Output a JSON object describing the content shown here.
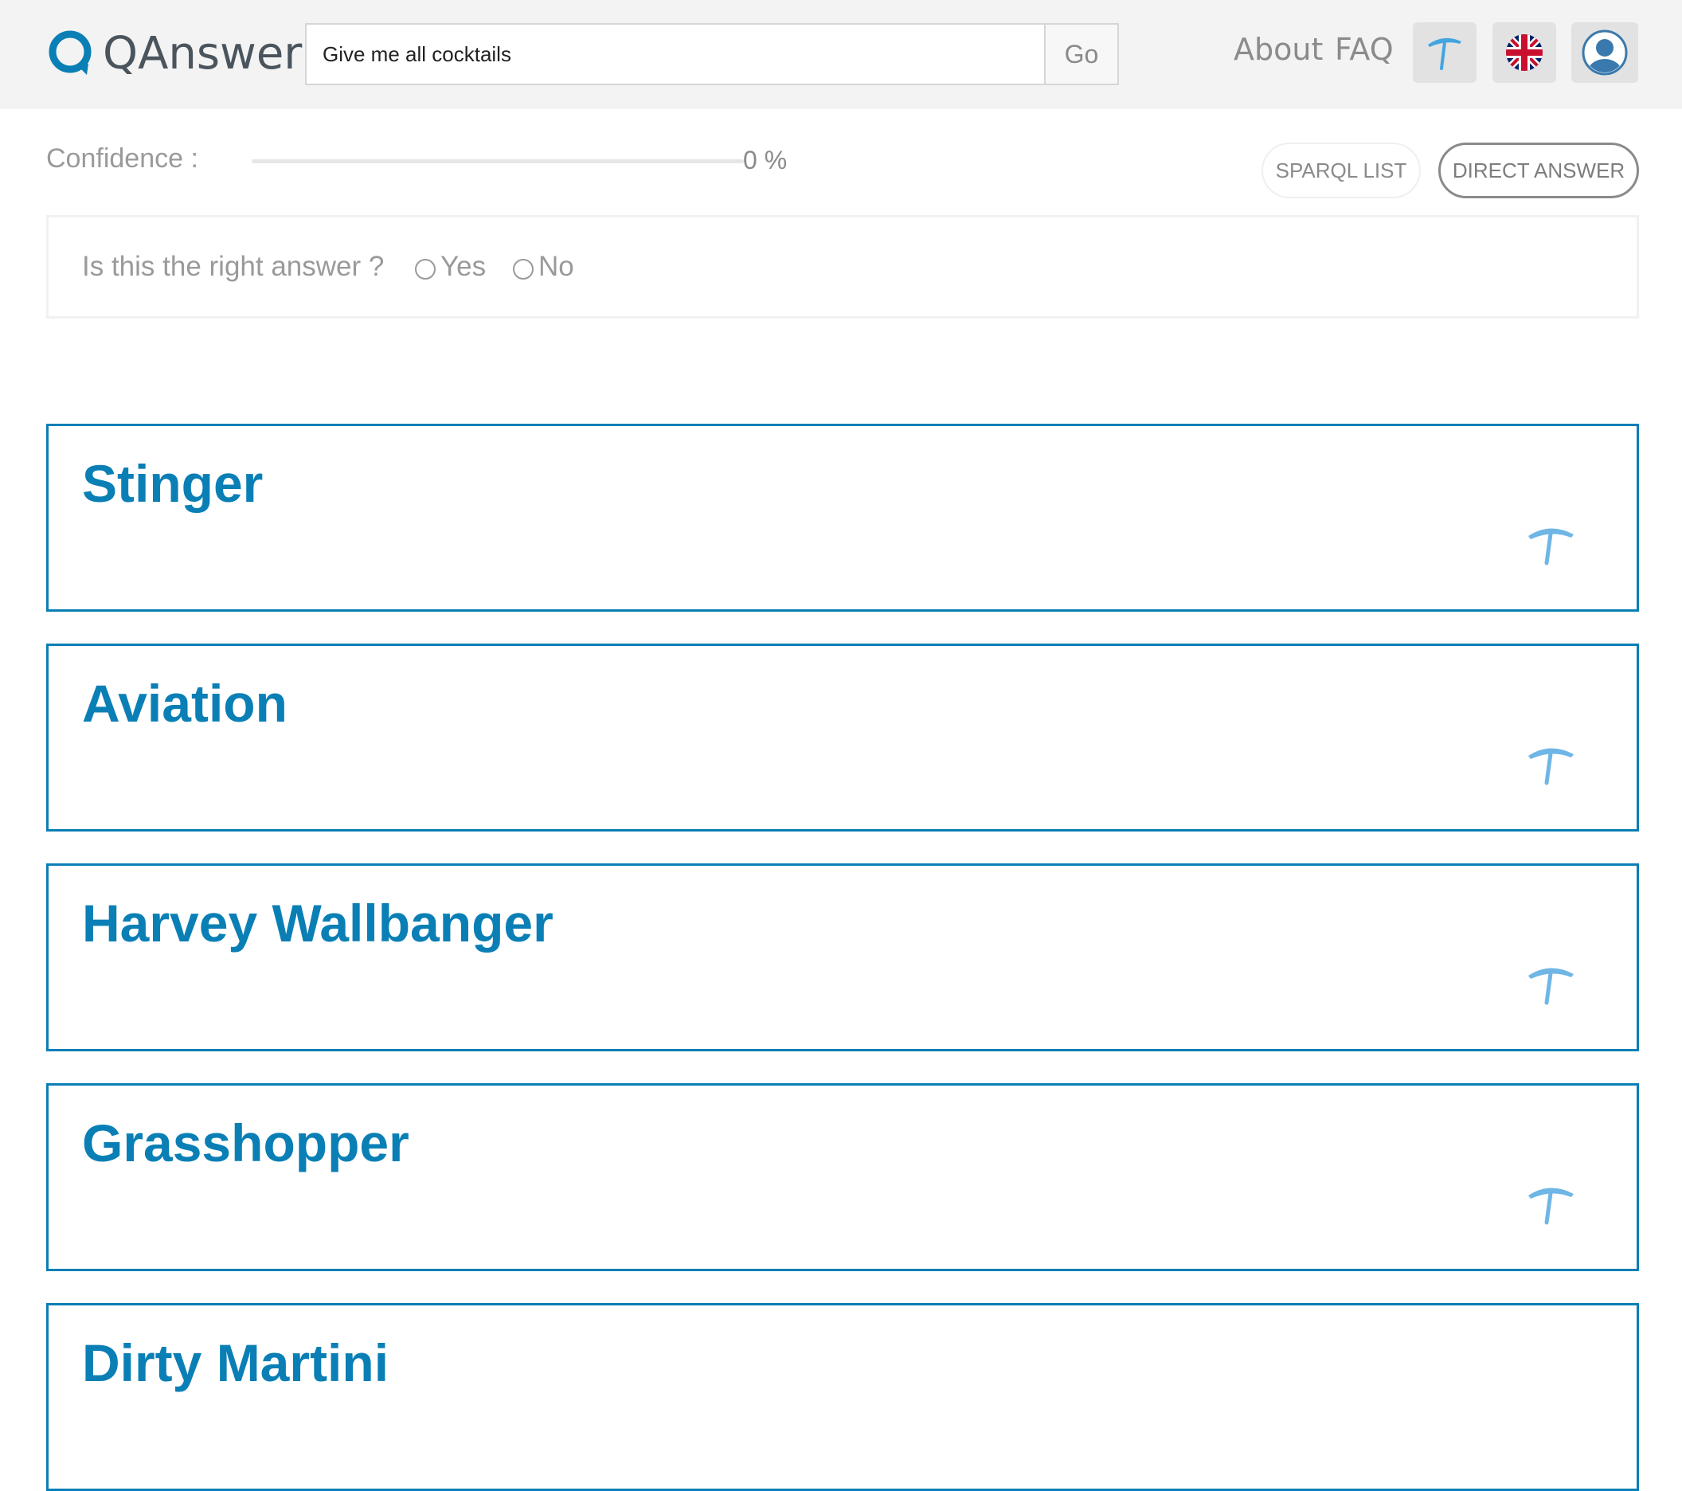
{
  "header": {
    "logo_text": "QAnswer",
    "search_value": "Give me all cocktails",
    "go_label": "Go",
    "about_label": "About",
    "faq_label": "FAQ",
    "umbrella_icon": "umbrella-icon",
    "flag_icon": "uk-flag-icon",
    "user_icon": "user-avatar-icon"
  },
  "confidence": {
    "label": "Confidence :",
    "value_text": "0 %",
    "value": 0
  },
  "view_toggle": {
    "sparql_list": "SPARQL LIST",
    "direct_answer": "DIRECT ANSWER"
  },
  "feedback": {
    "question": "Is this the right answer ?",
    "yes": "Yes",
    "no": "No"
  },
  "results": [
    {
      "title": "Stinger",
      "icon": "umbrella-icon"
    },
    {
      "title": "Aviation",
      "icon": "umbrella-icon"
    },
    {
      "title": "Harvey Wallbanger",
      "icon": "umbrella-icon"
    },
    {
      "title": "Grasshopper",
      "icon": "umbrella-icon"
    },
    {
      "title": "Dirty Martini",
      "icon": "umbrella-icon"
    }
  ],
  "colors": {
    "accent": "#0a7fb5",
    "icon_blue": "#6fb6e6",
    "header_bg": "#f3f3f3"
  }
}
